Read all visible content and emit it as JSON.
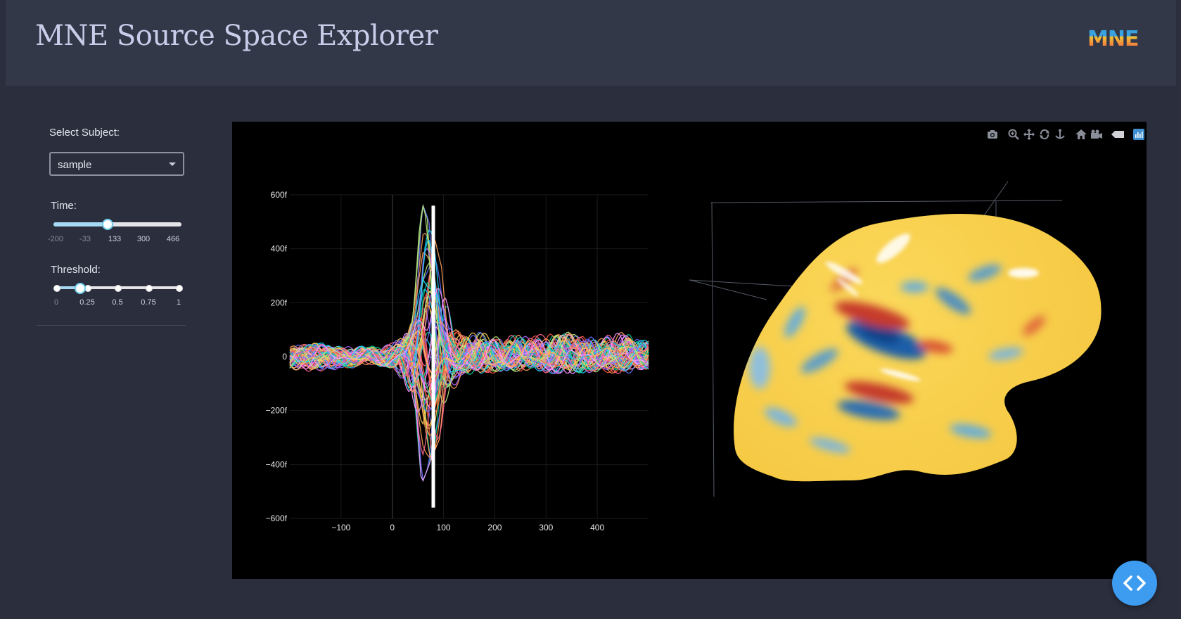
{
  "header": {
    "title": "MNE Source Space Explorer",
    "logo_text": "MNE"
  },
  "sidebar": {
    "subject": {
      "label": "Select Subject:",
      "value": "sample"
    },
    "time_slider": {
      "label": "Time:",
      "marks": [
        "-200",
        "-33",
        "133",
        "300",
        "466"
      ],
      "min": -200,
      "max": 466,
      "value": 80
    },
    "threshold_slider": {
      "label": "Threshold:",
      "marks": [
        "0",
        "0.25",
        "0.5",
        "0.75",
        "1"
      ],
      "min": 0,
      "max": 1,
      "value": 0.2
    }
  },
  "modebar": {
    "icons": [
      "camera-icon",
      "zoom-icon",
      "pan-icon",
      "orbit-icon",
      "turntable-icon",
      "home-icon",
      "video-camera-icon",
      "hover-tag-icon",
      "plotly-logo-icon"
    ]
  },
  "chart_data": [
    {
      "type": "line",
      "x_tick_labels": [
        "−100",
        "0",
        "100",
        "200",
        "300",
        "400"
      ],
      "x_ticks": [
        -100,
        0,
        100,
        200,
        300,
        400
      ],
      "y_tick_labels": [
        "600f",
        "400f",
        "200f",
        "0",
        "−200f",
        "−400f",
        "−600f"
      ],
      "y_ticks": [
        600,
        400,
        200,
        0,
        -200,
        -400,
        -600
      ],
      "xlim": [
        -200,
        500
      ],
      "ylim": [
        -600,
        600
      ],
      "y_unit_scale": "1e-15",
      "grid": true,
      "time_cursor": 80,
      "n_series": 60,
      "colors": [
        "#636efa",
        "#ef553b",
        "#00cc96",
        "#ab63fa",
        "#ffa15a",
        "#19d3f3",
        "#ff6692",
        "#b6e880",
        "#ff97ff",
        "#fecb52"
      ],
      "envelope": {
        "x": [
          -200,
          -150,
          -100,
          -50,
          0,
          20,
          40,
          60,
          80,
          100,
          120,
          140,
          160,
          200,
          250,
          300,
          350,
          400,
          450,
          500
        ],
        "peak_y": [
          80,
          120,
          80,
          90,
          110,
          160,
          350,
          560,
          460,
          300,
          160,
          200,
          200,
          180,
          170,
          180,
          200,
          170,
          200,
          150
        ],
        "trough_y": [
          -120,
          -120,
          -100,
          -80,
          -90,
          -200,
          -380,
          -460,
          -360,
          -270,
          -200,
          -160,
          -140,
          -130,
          -120,
          -130,
          -150,
          -120,
          -140,
          -110
        ]
      }
    },
    {
      "type": "surface",
      "description_3d": "inflated cortical surface colored by source amplitude",
      "colorscale": [
        "#1f5fa8",
        "#6aaed6",
        "#f9d34a",
        "#f4c542",
        "#d7301f"
      ]
    }
  ],
  "colors": {
    "background": "#2b2e3d",
    "header": "#333849",
    "title": "#c9cde9",
    "slider_track": "#a6d9f2",
    "slider_handle_border": "#6ecbeb",
    "fab": "#3d9cf0"
  }
}
